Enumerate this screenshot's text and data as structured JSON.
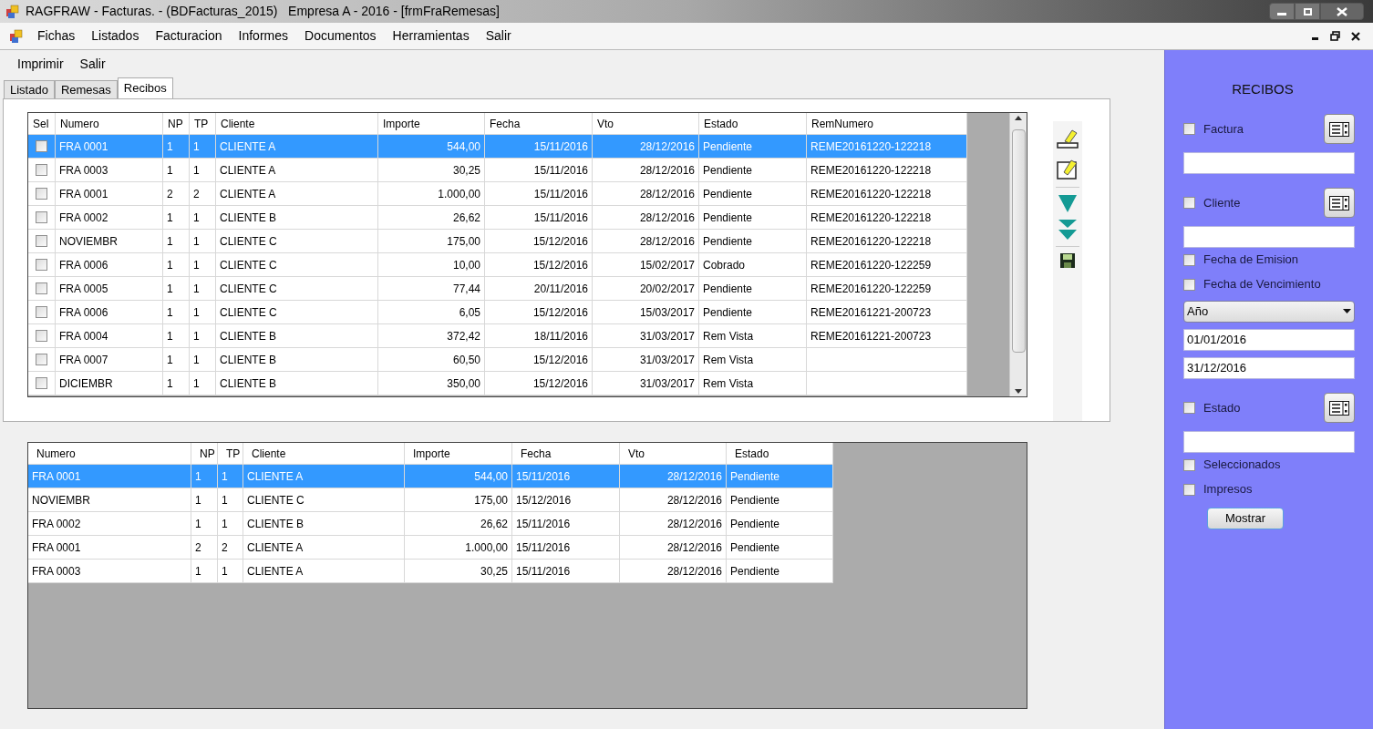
{
  "window": {
    "title": "RAGFRAW - Facturas. - (BDFacturas_2015)   Empresa A - 2016 - [frmFraRemesas]"
  },
  "menu_bar": [
    "Fichas",
    "Listados",
    "Facturacion",
    "Informes",
    "Documentos",
    "Herramientas",
    "Salir"
  ],
  "toolbar": [
    "Imprimir",
    "Salir"
  ],
  "tabs": [
    {
      "label": "Listado",
      "selected": false
    },
    {
      "label": "Remesas",
      "selected": false
    },
    {
      "label": "Recibos",
      "selected": true
    }
  ],
  "receipts_table": {
    "checkbox_column": "Sel",
    "columns": [
      "Numero",
      "NP",
      "TP",
      "Cliente",
      "Importe",
      "Fecha",
      "Vto",
      "Estado",
      "RemNumero"
    ],
    "rows": [
      {
        "selected": true,
        "checked": false,
        "cells": [
          "FRA 0001",
          "1",
          "1",
          "CLIENTE A",
          "544,00",
          "15/11/2016",
          "28/12/2016",
          "Pendiente",
          "REME20161220-122218"
        ]
      },
      {
        "selected": false,
        "checked": false,
        "cells": [
          "FRA 0003",
          "1",
          "1",
          "CLIENTE A",
          "30,25",
          "15/11/2016",
          "28/12/2016",
          "Pendiente",
          "REME20161220-122218"
        ]
      },
      {
        "selected": false,
        "checked": false,
        "cells": [
          "FRA 0001",
          "2",
          "2",
          "CLIENTE A",
          "1.000,00",
          "15/11/2016",
          "28/12/2016",
          "Pendiente",
          "REME20161220-122218"
        ]
      },
      {
        "selected": false,
        "checked": false,
        "cells": [
          "FRA 0002",
          "1",
          "1",
          "CLIENTE B",
          "26,62",
          "15/11/2016",
          "28/12/2016",
          "Pendiente",
          "REME20161220-122218"
        ]
      },
      {
        "selected": false,
        "checked": false,
        "cells": [
          "NOVIEMBR",
          "1",
          "1",
          "CLIENTE C",
          "175,00",
          "15/12/2016",
          "28/12/2016",
          "Pendiente",
          "REME20161220-122218"
        ]
      },
      {
        "selected": false,
        "checked": false,
        "cells": [
          "FRA 0006",
          "1",
          "1",
          "CLIENTE C",
          "10,00",
          "15/12/2016",
          "15/02/2017",
          "Cobrado",
          "REME20161220-122259"
        ]
      },
      {
        "selected": false,
        "checked": false,
        "cells": [
          "FRA 0005",
          "1",
          "1",
          "CLIENTE C",
          "77,44",
          "20/11/2016",
          "20/02/2017",
          "Pendiente",
          "REME20161220-122259"
        ]
      },
      {
        "selected": false,
        "checked": false,
        "cells": [
          "FRA 0006",
          "1",
          "1",
          "CLIENTE C",
          "6,05",
          "15/12/2016",
          "15/03/2017",
          "Pendiente",
          "REME20161221-200723"
        ]
      },
      {
        "selected": false,
        "checked": false,
        "cells": [
          "FRA 0004",
          "1",
          "1",
          "CLIENTE B",
          "372,42",
          "18/11/2016",
          "31/03/2017",
          "Rem Vista",
          "REME20161221-200723"
        ]
      },
      {
        "selected": false,
        "checked": false,
        "cells": [
          "FRA 0007",
          "1",
          "1",
          "CLIENTE B",
          "60,50",
          "15/12/2016",
          "31/03/2017",
          "Rem Vista",
          ""
        ]
      },
      {
        "selected": false,
        "checked": false,
        "cells": [
          "DICIEMBR",
          "1",
          "1",
          "CLIENTE B",
          "350,00",
          "15/12/2016",
          "31/03/2017",
          "Rem Vista",
          ""
        ]
      }
    ]
  },
  "remittance_table": {
    "columns": [
      "Numero",
      "NP",
      "TP",
      "Cliente",
      "Importe",
      "Fecha",
      "Vto",
      "Estado"
    ],
    "rows": [
      {
        "selected": true,
        "cells": [
          "FRA 0001",
          "1",
          "1",
          "CLIENTE A",
          "544,00",
          "15/11/2016",
          "28/12/2016",
          "Pendiente"
        ]
      },
      {
        "selected": false,
        "cells": [
          "NOVIEMBR",
          "1",
          "1",
          "CLIENTE C",
          "175,00",
          "15/12/2016",
          "28/12/2016",
          "Pendiente"
        ]
      },
      {
        "selected": false,
        "cells": [
          "FRA 0002",
          "1",
          "1",
          "CLIENTE B",
          "26,62",
          "15/11/2016",
          "28/12/2016",
          "Pendiente"
        ]
      },
      {
        "selected": false,
        "cells": [
          "FRA 0001",
          "2",
          "2",
          "CLIENTE A",
          "1.000,00",
          "15/11/2016",
          "28/12/2016",
          "Pendiente"
        ]
      },
      {
        "selected": false,
        "cells": [
          "FRA 0003",
          "1",
          "1",
          "CLIENTE A",
          "30,25",
          "15/11/2016",
          "28/12/2016",
          "Pendiente"
        ]
      }
    ]
  },
  "filter_panel": {
    "title": "RECIBOS",
    "items": [
      {
        "kind": "checkbox",
        "label": "Factura",
        "checked": false,
        "picker": true
      },
      {
        "kind": "input"
      },
      {
        "kind": "checkbox",
        "label": "Cliente",
        "checked": false,
        "picker": true
      },
      {
        "kind": "input"
      },
      {
        "kind": "checkbox",
        "label": "Fecha de Emision",
        "checked": false,
        "picker": false
      },
      {
        "kind": "checkbox",
        "label": "Fecha de Vencimiento",
        "checked": false,
        "picker": false
      },
      {
        "kind": "select",
        "value": "Año"
      },
      {
        "kind": "input",
        "value": "01/01/2016"
      },
      {
        "kind": "input",
        "value": "31/12/2016"
      },
      {
        "kind": "checkbox",
        "label": "Estado",
        "checked": false,
        "picker": true
      },
      {
        "kind": "input"
      },
      {
        "kind": "checkbox",
        "label": "Seleccionados",
        "checked": false,
        "picker": false
      },
      {
        "kind": "checkbox",
        "label": "Impresos",
        "checked": false,
        "picker": false
      },
      {
        "kind": "button",
        "label": "Mostrar"
      }
    ]
  }
}
